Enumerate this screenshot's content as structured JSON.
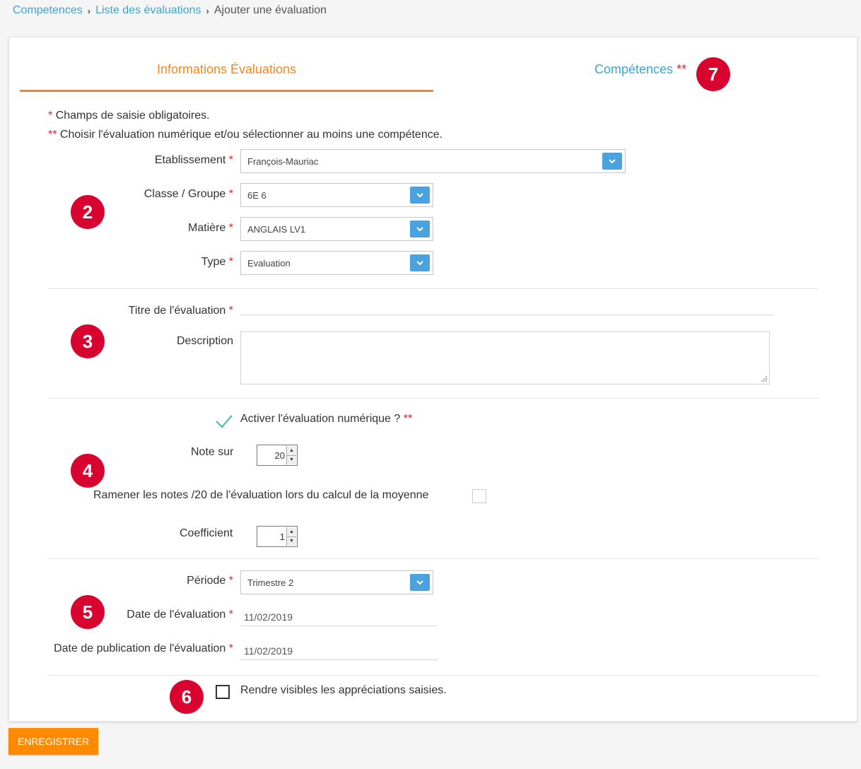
{
  "breadcrumb": {
    "items": [
      "Competences",
      "Liste des évaluations"
    ],
    "current": "Ajouter une évaluation"
  },
  "tabs": {
    "info": "Informations Évaluations",
    "competences": "Compétences",
    "competences_marker": "**"
  },
  "notes": {
    "required_marker": "*",
    "required_text": "Champs de saisie obligatoires.",
    "double_marker": "**",
    "double_text": "Choisir l'évaluation numérique et/ou sélectionner au moins une compétence."
  },
  "badges": [
    "2",
    "3",
    "4",
    "5",
    "6",
    "7"
  ],
  "form": {
    "etablissement": {
      "label": "Etablissement",
      "value": "François-Mauriac"
    },
    "classe": {
      "label": "Classe / Groupe",
      "value": "6E 6"
    },
    "matiere": {
      "label": "Matière",
      "value": "ANGLAIS LV1"
    },
    "type": {
      "label": "Type",
      "value": "Evaluation"
    },
    "titre": {
      "label": "Titre de l'évaluation",
      "value": ""
    },
    "description": {
      "label": "Description",
      "value": ""
    },
    "activer": {
      "label": "Activer l'évaluation numérique ?",
      "marker": "**"
    },
    "note_sur": {
      "label": "Note sur",
      "value": "20"
    },
    "ramener": {
      "label": "Ramener les notes /20 de l'évaluation lors du calcul de la moyenne"
    },
    "coefficient": {
      "label": "Coefficient",
      "value": "1"
    },
    "periode": {
      "label": "Période",
      "value": "Trimestre 2"
    },
    "date_eval": {
      "label": "Date de l'évaluation",
      "value": "11/02/2019"
    },
    "date_pub": {
      "label": "Date de publication de l'évaluation",
      "value": "11/02/2019"
    },
    "visibles": {
      "label": "Rendre visibles les appréciations saisies."
    }
  },
  "actions": {
    "save": "ENREGISTRER"
  },
  "colors": {
    "accent": "#f5861f",
    "link": "#3da4d0",
    "badge": "#d8042f",
    "select_button": "#4aa3df",
    "required": "#e0242e"
  }
}
